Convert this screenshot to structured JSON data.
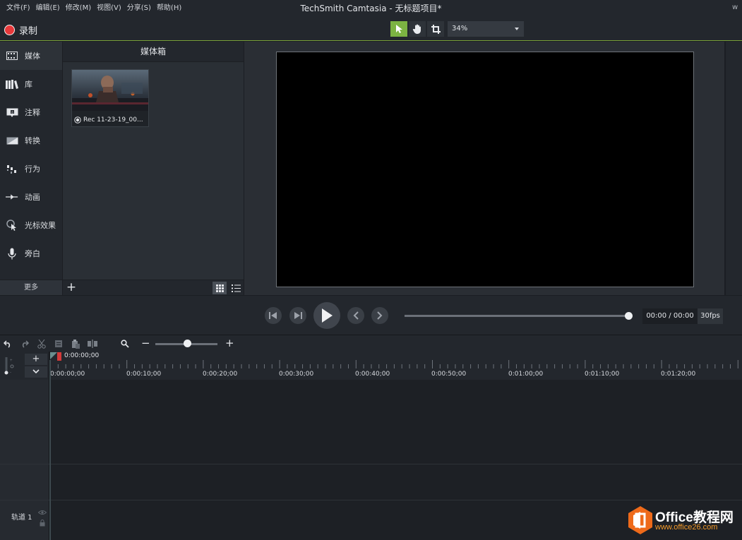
{
  "window": {
    "title": "TechSmith Camtasia - 无标题项目*",
    "partial_control": "w"
  },
  "menu": [
    {
      "label": "文件(F)"
    },
    {
      "label": "编辑(E)"
    },
    {
      "label": "修改(M)"
    },
    {
      "label": "视图(V)"
    },
    {
      "label": "分享(S)"
    },
    {
      "label": "帮助(H)"
    }
  ],
  "toolbar": {
    "record_label": "录制",
    "tools": [
      "pointer-tool-icon",
      "pan-hand-icon",
      "crop-icon"
    ],
    "zoom_value": "34%"
  },
  "colors": {
    "accent_green": "#7cb342",
    "record_red": "#e8383a",
    "playhead_red": "#d33a3a"
  },
  "rail": {
    "items": [
      {
        "label": "媒体",
        "icon": "media-film-icon"
      },
      {
        "label": "库",
        "icon": "library-books-icon"
      },
      {
        "label": "注释",
        "icon": "annotation-icon"
      },
      {
        "label": "转换",
        "icon": "transition-icon"
      },
      {
        "label": "行为",
        "icon": "behavior-icon"
      },
      {
        "label": "动画",
        "icon": "animation-arrow-icon"
      },
      {
        "label": "光标效果",
        "icon": "cursor-effect-icon"
      },
      {
        "label": "旁白",
        "icon": "microphone-icon"
      }
    ],
    "more_label": "更多"
  },
  "media_bin": {
    "title": "媒体箱",
    "items": [
      {
        "name": "Rec 11-23-19_00..."
      }
    ]
  },
  "playback": {
    "timecode": "00:00 / 00:00",
    "fps": "30fps"
  },
  "timeline": {
    "playhead_time": "0:00:00;00",
    "ruler_labels": [
      "0:00:00;00",
      "0:00:10;00",
      "0:00:20;00",
      "0:00:30;00",
      "0:00:40;00",
      "0:00:50;00",
      "0:01:00;00",
      "0:01:10;00",
      "0:01:20;00"
    ],
    "track_label": "轨道 1"
  },
  "watermark": {
    "title": "Office教程网",
    "url": "www.office26.com"
  }
}
